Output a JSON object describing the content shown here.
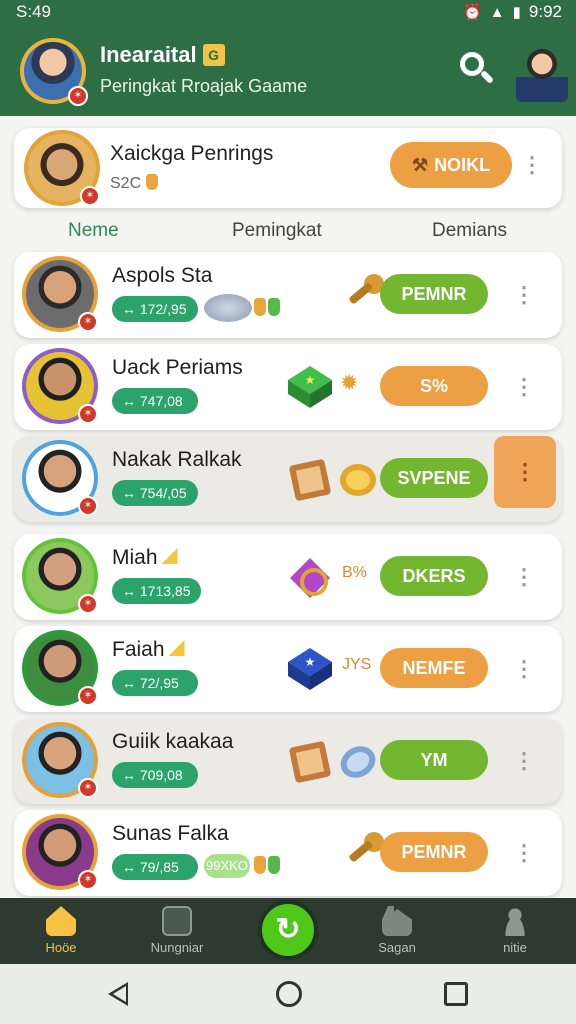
{
  "status_bar": {
    "time_left": "S:49",
    "time_right": "9:92"
  },
  "header": {
    "title": "Inearaital",
    "title_badge": "G",
    "subtitle": "Peringkat Rroajak Gaame"
  },
  "featured": {
    "name": "Xaickga Penrings",
    "sub": "S2C",
    "button": "NOIKL"
  },
  "tabs": [
    {
      "label": "Neme",
      "active": true
    },
    {
      "label": "Pemingkat",
      "active": false
    },
    {
      "label": "Demians",
      "active": false
    }
  ],
  "rows": [
    {
      "name": "Aspols Sta",
      "score": "↔ 172/,95",
      "button": "PEMNR",
      "button_color": "green",
      "ring": "#e3a23a",
      "extra": ""
    },
    {
      "name": "Uack Periams",
      "score": "↔ 747,08",
      "button": "S%",
      "button_color": "orange",
      "ring": "#8e5ec7",
      "extra": ""
    },
    {
      "name": "Nakak Ralkak",
      "score": "↔ 754/,05",
      "button": "SVPENE",
      "button_color": "green",
      "ring": "#4fa3e0",
      "extra": ""
    },
    {
      "name": "Miah",
      "score": "↔ 1713,85",
      "button": "DKERS",
      "button_color": "green",
      "ring": "#63c43a",
      "extra": "B%"
    },
    {
      "name": "Faiah",
      "score": "↔ 72/,95",
      "button": "NEMFE",
      "button_color": "orange",
      "ring": "#2f9a3c",
      "extra": "JYS"
    },
    {
      "name": "Guiik kaakaa",
      "score": "↔ 709,08",
      "button": "YM",
      "button_color": "green",
      "ring": "#e3a23a",
      "extra": ""
    },
    {
      "name": "Sunas Falka",
      "score": "↔ 79/,85",
      "button": "PEMNR",
      "button_color": "orange",
      "ring": "#e3a23a",
      "extra": "",
      "tag": "99XKO"
    }
  ],
  "bottom_nav": [
    {
      "label": "Hoöe",
      "icon": "home-icon",
      "active": true
    },
    {
      "label": "Nungniar",
      "icon": "ranking-icon",
      "active": false
    },
    {
      "label": "Sagan",
      "icon": "shop-icon",
      "active": false
    },
    {
      "label": "nitie",
      "icon": "profile-icon",
      "active": false
    }
  ],
  "colors": {
    "header": "#2d6e45",
    "accent_green": "#2ca36a",
    "accent_orange": "#eda043",
    "pill_green": "#72b72f"
  }
}
